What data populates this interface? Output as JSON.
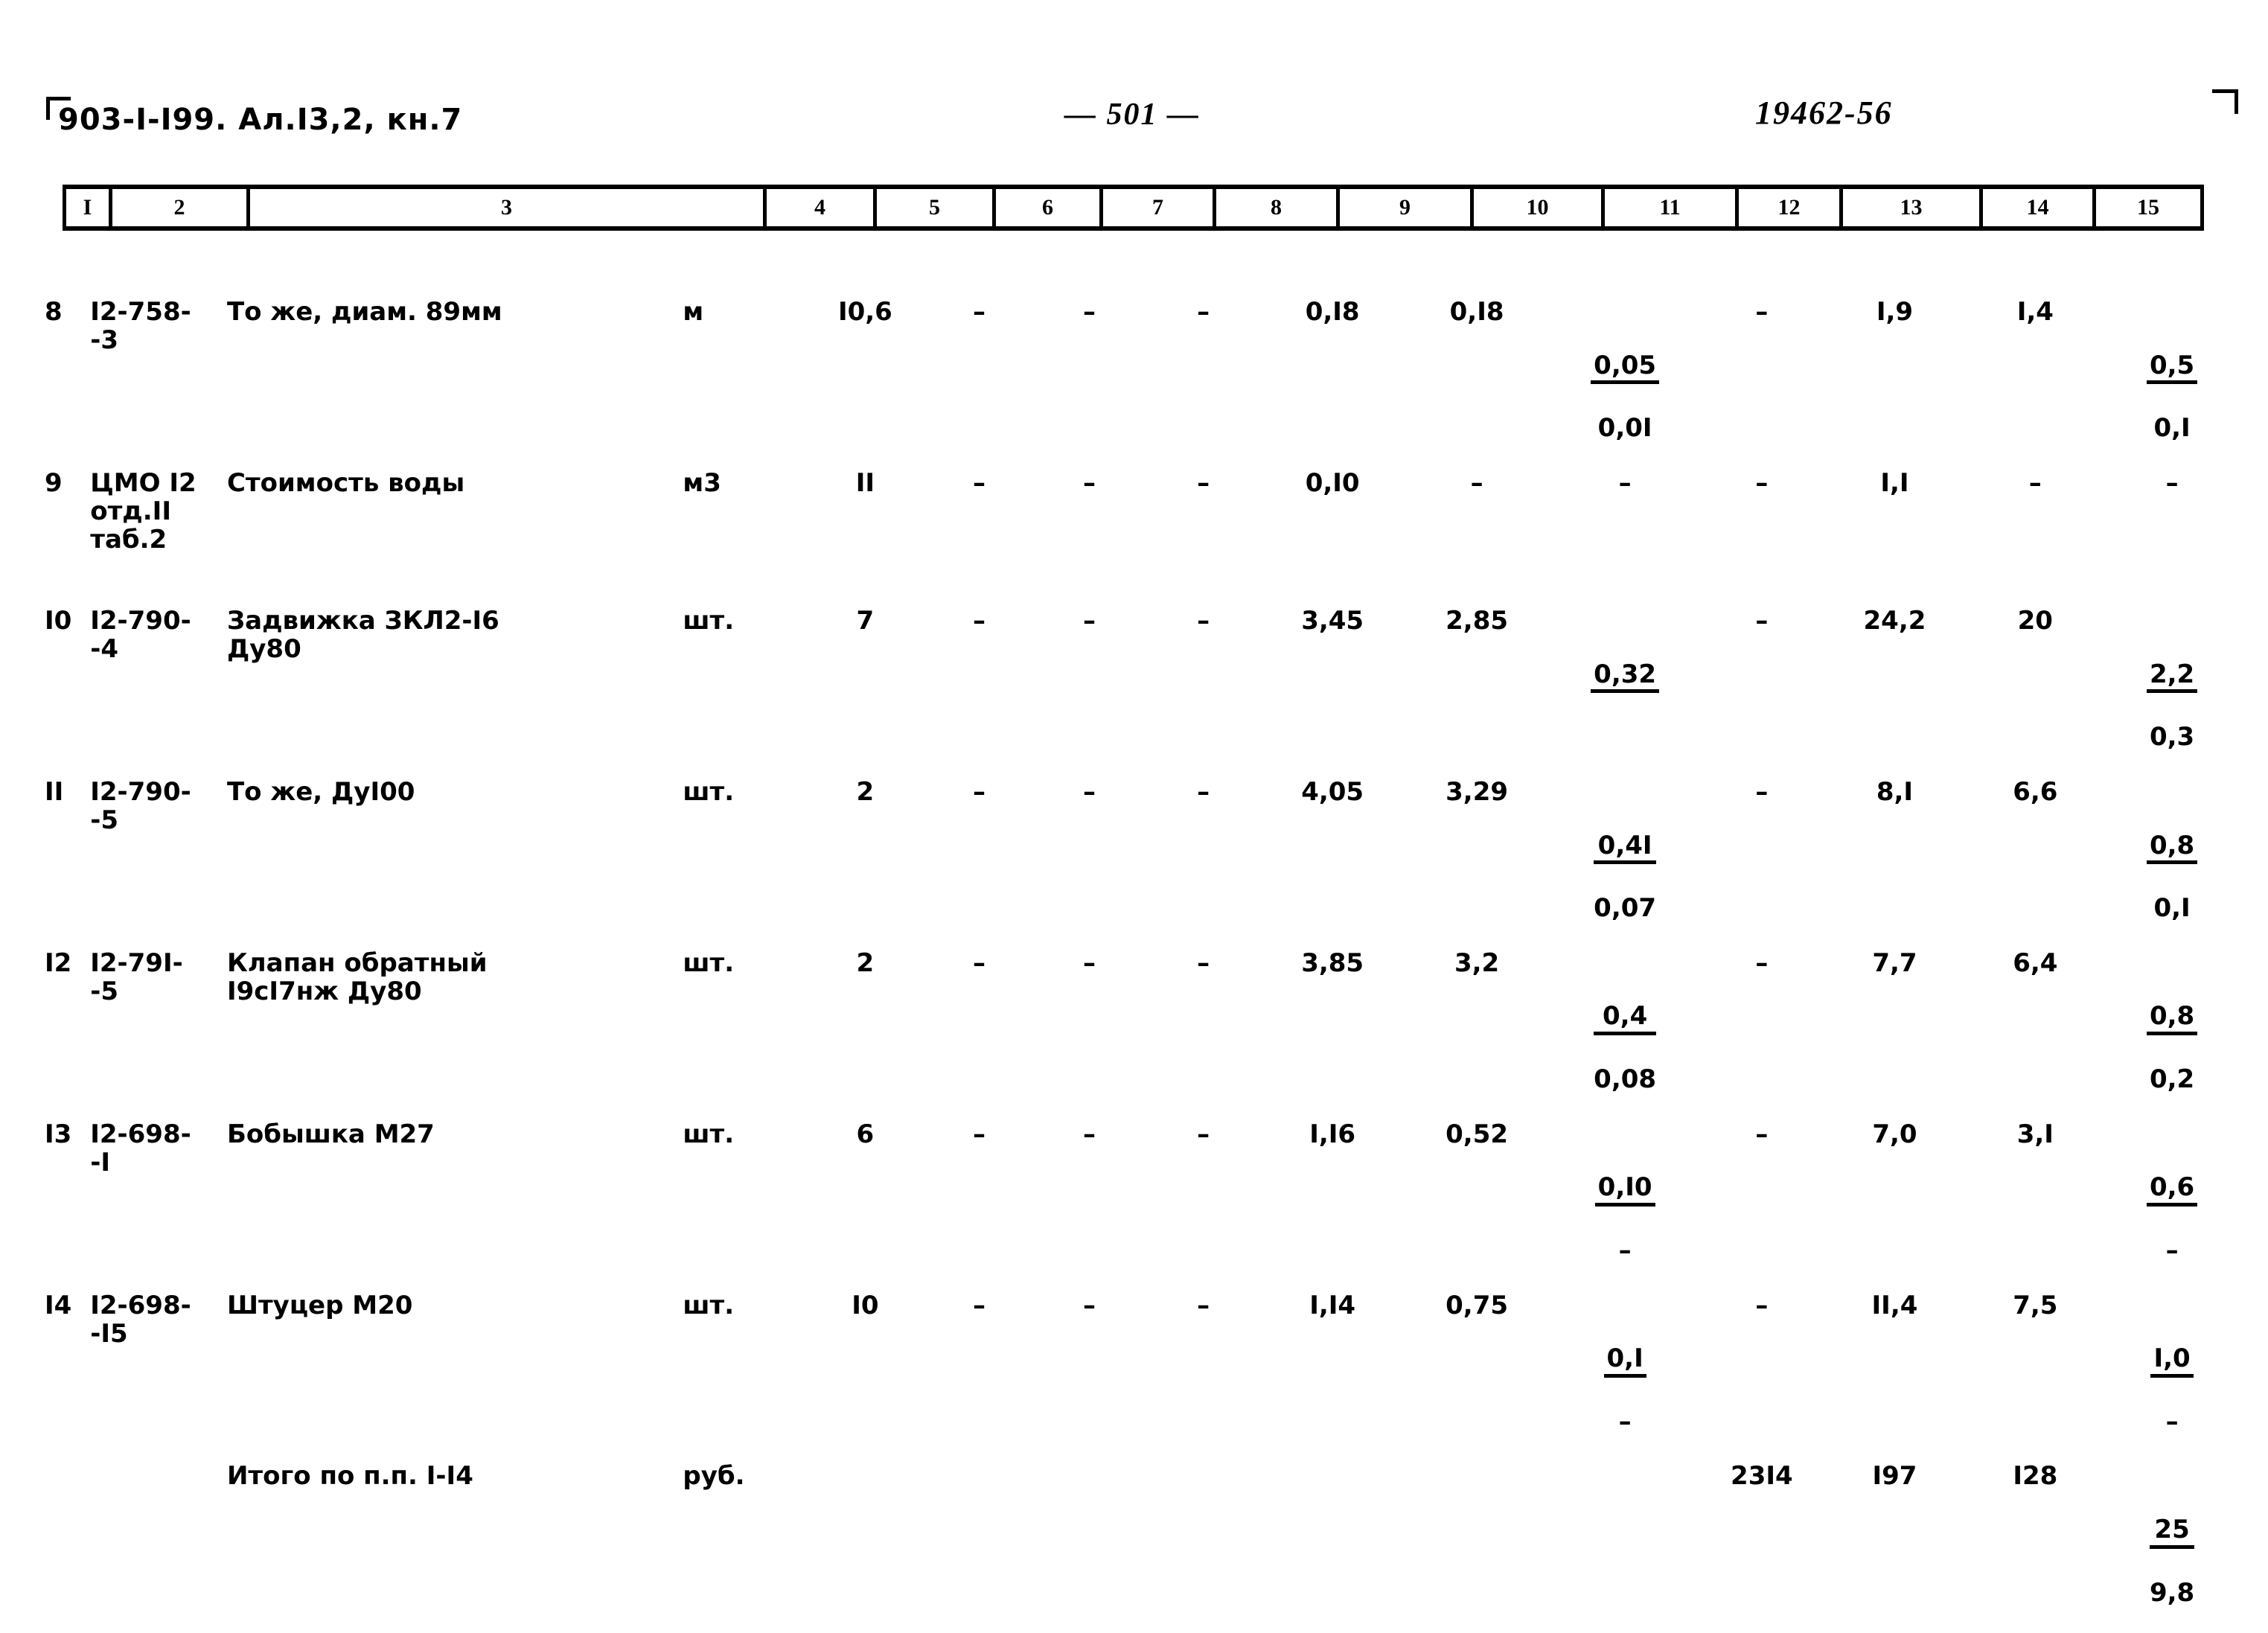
{
  "header": {
    "doc_code": "903-I-I99. Ал.I3,2, кн.7",
    "page_number": "— 501 —",
    "archive_number": "19462-56"
  },
  "table": {
    "column_numbers": [
      "I",
      "2",
      "3",
      "4",
      "5",
      "6",
      "7",
      "8",
      "9",
      "10",
      "11",
      "12",
      "13",
      "14",
      "15"
    ],
    "rows": [
      {
        "num": "8",
        "code": "I2-758-\n-3",
        "name": "То же, диам. 89мм",
        "unit": "м",
        "qty": "I0,6",
        "c6": "–",
        "c7": "–",
        "c8": "–",
        "c9": "0,I8",
        "c10": "0,I8",
        "c11_top": "0,05",
        "c11_bot": "0,0I",
        "c12": "–",
        "c13": "I,9",
        "c14": "I,4",
        "c15_top": "0,5",
        "c15_bot": "0,I"
      },
      {
        "num": "9",
        "code": "ЦМО I2\nотд.II\nтаб.2",
        "name": "Стоимость воды",
        "unit": "м3",
        "qty": "II",
        "c6": "–",
        "c7": "–",
        "c8": "–",
        "c9": "0,I0",
        "c10": "–",
        "c11_top": "–",
        "c11_bot": "",
        "c12": "–",
        "c13": "I,I",
        "c14": "–",
        "c15_top": "–",
        "c15_bot": ""
      },
      {
        "num": "I0",
        "code": "I2-790-\n-4",
        "name": "Задвижка ЗКЛ2-I6\nДу80",
        "unit": "шт.",
        "qty": "7",
        "c6": "–",
        "c7": "–",
        "c8": "–",
        "c9": "3,45",
        "c10": "2,85",
        "c11_top": "0,32",
        "c11_bot": "",
        "c12": "–",
        "c13": "24,2",
        "c14": "20",
        "c15_top": "2,2",
        "c15_bot": "0,3"
      },
      {
        "num": "II",
        "code": "I2-790-\n-5",
        "name": "То же, ДуI00",
        "unit": "шт.",
        "qty": "2",
        "c6": "–",
        "c7": "–",
        "c8": "–",
        "c9": "4,05",
        "c10": "3,29",
        "c11_top": "0,4I",
        "c11_bot": "0,07",
        "c12": "–",
        "c13": "8,I",
        "c14": "6,6",
        "c15_top": "0,8",
        "c15_bot": "0,I"
      },
      {
        "num": "I2",
        "code": "I2-79I-\n-5",
        "name": "Клапан обратный\nI9сI7нж   Ду80",
        "unit": "шт.",
        "qty": "2",
        "c6": "–",
        "c7": "–",
        "c8": "–",
        "c9": "3,85",
        "c10": "3,2",
        "c11_top": "0,4",
        "c11_bot": "0,08",
        "c12": "–",
        "c13": "7,7",
        "c14": "6,4",
        "c15_top": "0,8",
        "c15_bot": "0,2"
      },
      {
        "num": "I3",
        "code": "I2-698-\n-I",
        "name": "Бобышка М27",
        "unit": "шт.",
        "qty": "6",
        "c6": "–",
        "c7": "–",
        "c8": "–",
        "c9": "I,I6",
        "c10": "0,52",
        "c11_top": "0,I0",
        "c11_bot": "–",
        "c12": "–",
        "c13": "7,0",
        "c14": "3,I",
        "c15_top": "0,6",
        "c15_bot": "–"
      },
      {
        "num": "I4",
        "code": "I2-698-\n-I5",
        "name": "Штуцер М20",
        "unit": "шт.",
        "qty": "I0",
        "c6": "–",
        "c7": "–",
        "c8": "–",
        "c9": "I,I4",
        "c10": "0,75",
        "c11_top": "0,I",
        "c11_bot": "–",
        "c12": "–",
        "c13": "II,4",
        "c14": "7,5",
        "c15_top": "I,0",
        "c15_bot": "–"
      }
    ],
    "totals": {
      "label": "Итого по п.п. I-I4",
      "unit": "руб.",
      "c12": "23I4",
      "c13": "I97",
      "c14": "I28",
      "c15_top": "25",
      "c15_bot": "9,8"
    }
  }
}
